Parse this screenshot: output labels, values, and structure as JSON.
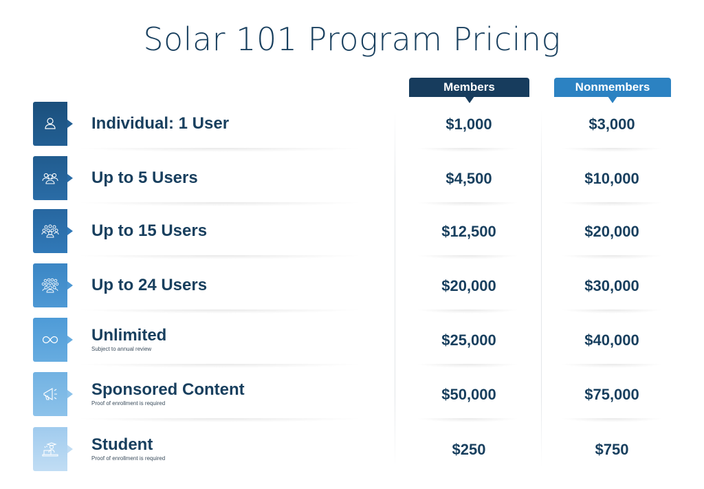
{
  "title": "Solar 101 Program Pricing",
  "columns": {
    "members": "Members",
    "nonmembers": "Nonmembers"
  },
  "colors": {
    "members_header": "#173c5d",
    "nonmembers_header": "#2c82c2",
    "text": "#183f5e"
  },
  "tiers": [
    {
      "icon": "single-user-icon",
      "label": "Individual: 1 User",
      "note": "",
      "members_price": "$1,000",
      "nonmembers_price": "$3,000",
      "color": "#1f5a8a"
    },
    {
      "icon": "small-group-icon",
      "label": "Up to 5 Users",
      "note": "",
      "members_price": "$4,500",
      "nonmembers_price": "$10,000",
      "color": "#24659b"
    },
    {
      "icon": "medium-group-icon",
      "label": "Up to 15 Users",
      "note": "",
      "members_price": "$12,500",
      "nonmembers_price": "$20,000",
      "color": "#2e74b0"
    },
    {
      "icon": "large-group-icon",
      "label": "Up to 24 Users",
      "note": "",
      "members_price": "$20,000",
      "nonmembers_price": "$30,000",
      "color": "#4390cd"
    },
    {
      "icon": "infinity-icon",
      "label": "Unlimited",
      "note": "Subject to annual review",
      "members_price": "$25,000",
      "nonmembers_price": "$40,000",
      "color": "#5aa3dc"
    },
    {
      "icon": "megaphone-icon",
      "label": "Sponsored Content",
      "note": "Proof of enrollment is required",
      "members_price": "$50,000",
      "nonmembers_price": "$75,000",
      "color": "#7cb8e4"
    },
    {
      "icon": "student-icon",
      "label": "Student",
      "note": "Proof of enrollment is required",
      "members_price": "$250",
      "nonmembers_price": "$750",
      "color": "#a9d0ef"
    }
  ]
}
